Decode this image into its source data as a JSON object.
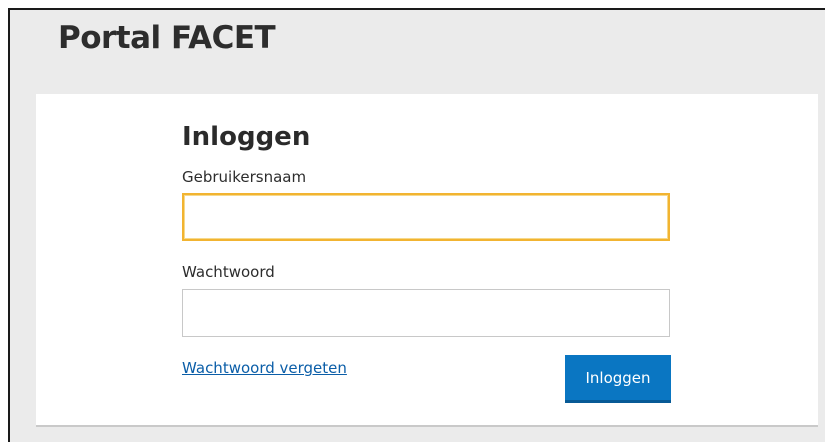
{
  "header": {
    "title": "Portal FACET"
  },
  "login": {
    "title": "Inloggen",
    "username": {
      "label": "Gebruikersnaam",
      "value": ""
    },
    "password": {
      "label": "Wachtwoord",
      "value": ""
    },
    "forgot_link": "Wachtwoord vergeten",
    "submit_label": "Inloggen"
  },
  "colors": {
    "page_background": "#ebebeb",
    "focus_border": "#f2b431",
    "link": "#0b5ea8",
    "button": "#0a76c2"
  }
}
